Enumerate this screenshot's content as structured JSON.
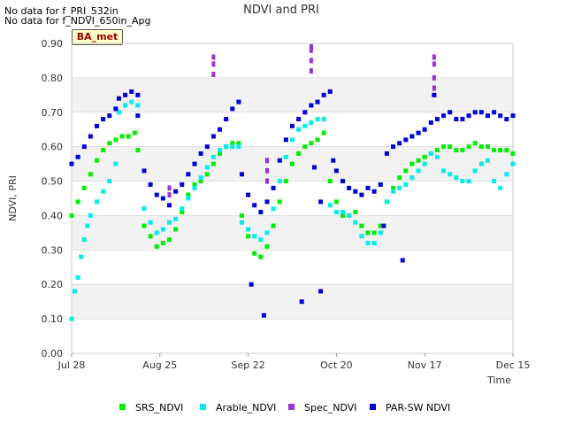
{
  "notes": [
    "No data for f_PRI_532in",
    "No data for f_NDVI_650in_Apg"
  ],
  "badge": "BA_met",
  "chart_data": {
    "type": "scatter",
    "title": "NDVI and PRI",
    "xlabel": "Time",
    "ylabel": "NDVI, PRI",
    "xlim": [
      "2019-07-28",
      "2019-12-15"
    ],
    "ylim": [
      0,
      0.9
    ],
    "x_ticks": [
      "Jul 28",
      "Aug 25",
      "Sep 22",
      "Oct 20",
      "Nov 17",
      "Dec 15"
    ],
    "y_ticks": [
      "0.00",
      "0.10",
      "0.20",
      "0.30",
      "0.40",
      "0.50",
      "0.60",
      "0.70",
      "0.80",
      "0.90"
    ],
    "grid": "horizontal bands",
    "legend_position": "bottom",
    "series": [
      {
        "name": "SRS_NDVI",
        "color": "#00ee00",
        "points": [
          [
            "2019-07-28",
            0.4
          ],
          [
            "2019-07-30",
            0.44
          ],
          [
            "2019-08-01",
            0.48
          ],
          [
            "2019-08-03",
            0.52
          ],
          [
            "2019-08-05",
            0.56
          ],
          [
            "2019-08-07",
            0.59
          ],
          [
            "2019-08-09",
            0.61
          ],
          [
            "2019-08-11",
            0.62
          ],
          [
            "2019-08-13",
            0.63
          ],
          [
            "2019-08-15",
            0.63
          ],
          [
            "2019-08-17",
            0.64
          ],
          [
            "2019-08-18",
            0.59
          ],
          [
            "2019-08-20",
            0.37
          ],
          [
            "2019-08-22",
            0.34
          ],
          [
            "2019-08-24",
            0.31
          ],
          [
            "2019-08-26",
            0.32
          ],
          [
            "2019-08-28",
            0.33
          ],
          [
            "2019-08-30",
            0.36
          ],
          [
            "2019-09-01",
            0.41
          ],
          [
            "2019-09-03",
            0.46
          ],
          [
            "2019-09-05",
            0.49
          ],
          [
            "2019-09-07",
            0.5
          ],
          [
            "2019-09-09",
            0.52
          ],
          [
            "2019-09-11",
            0.55
          ],
          [
            "2019-09-13",
            0.58
          ],
          [
            "2019-09-15",
            0.6
          ],
          [
            "2019-09-17",
            0.61
          ],
          [
            "2019-09-19",
            0.61
          ],
          [
            "2019-09-20",
            0.4
          ],
          [
            "2019-09-22",
            0.34
          ],
          [
            "2019-09-24",
            0.29
          ],
          [
            "2019-09-26",
            0.28
          ],
          [
            "2019-09-28",
            0.31
          ],
          [
            "2019-09-30",
            0.37
          ],
          [
            "2019-10-02",
            0.44
          ],
          [
            "2019-10-04",
            0.5
          ],
          [
            "2019-10-06",
            0.55
          ],
          [
            "2019-10-08",
            0.58
          ],
          [
            "2019-10-10",
            0.6
          ],
          [
            "2019-10-12",
            0.61
          ],
          [
            "2019-10-14",
            0.62
          ],
          [
            "2019-10-16",
            0.64
          ],
          [
            "2019-10-18",
            0.5
          ],
          [
            "2019-10-20",
            0.44
          ],
          [
            "2019-10-22",
            0.4
          ],
          [
            "2019-10-24",
            0.4
          ],
          [
            "2019-10-26",
            0.41
          ],
          [
            "2019-10-28",
            0.37
          ],
          [
            "2019-10-30",
            0.35
          ],
          [
            "2019-11-01",
            0.35
          ],
          [
            "2019-11-03",
            0.37
          ],
          [
            "2019-11-05",
            0.44
          ],
          [
            "2019-11-07",
            0.48
          ],
          [
            "2019-11-09",
            0.51
          ],
          [
            "2019-11-11",
            0.53
          ],
          [
            "2019-11-13",
            0.55
          ],
          [
            "2019-11-15",
            0.56
          ],
          [
            "2019-11-17",
            0.57
          ],
          [
            "2019-11-19",
            0.58
          ],
          [
            "2019-11-21",
            0.59
          ],
          [
            "2019-11-23",
            0.6
          ],
          [
            "2019-11-25",
            0.6
          ],
          [
            "2019-11-27",
            0.59
          ],
          [
            "2019-11-29",
            0.59
          ],
          [
            "2019-12-01",
            0.6
          ],
          [
            "2019-12-03",
            0.61
          ],
          [
            "2019-12-05",
            0.6
          ],
          [
            "2019-12-07",
            0.6
          ],
          [
            "2019-12-09",
            0.59
          ],
          [
            "2019-12-11",
            0.59
          ],
          [
            "2019-12-13",
            0.59
          ],
          [
            "2019-12-15",
            0.58
          ]
        ]
      },
      {
        "name": "Arable_NDVI",
        "color": "#00eeee",
        "points": [
          [
            "2019-07-28",
            0.1
          ],
          [
            "2019-07-29",
            0.18
          ],
          [
            "2019-07-30",
            0.22
          ],
          [
            "2019-07-31",
            0.28
          ],
          [
            "2019-08-01",
            0.33
          ],
          [
            "2019-08-02",
            0.37
          ],
          [
            "2019-08-03",
            0.4
          ],
          [
            "2019-08-05",
            0.44
          ],
          [
            "2019-08-07",
            0.47
          ],
          [
            "2019-08-09",
            0.5
          ],
          [
            "2019-08-11",
            0.55
          ],
          [
            "2019-08-12",
            0.7
          ],
          [
            "2019-08-14",
            0.72
          ],
          [
            "2019-08-16",
            0.73
          ],
          [
            "2019-08-18",
            0.72
          ],
          [
            "2019-08-20",
            0.42
          ],
          [
            "2019-08-22",
            0.38
          ],
          [
            "2019-08-24",
            0.35
          ],
          [
            "2019-08-26",
            0.36
          ],
          [
            "2019-08-28",
            0.38
          ],
          [
            "2019-08-30",
            0.39
          ],
          [
            "2019-09-01",
            0.42
          ],
          [
            "2019-09-03",
            0.45
          ],
          [
            "2019-09-05",
            0.48
          ],
          [
            "2019-09-07",
            0.51
          ],
          [
            "2019-09-09",
            0.54
          ],
          [
            "2019-09-11",
            0.57
          ],
          [
            "2019-09-13",
            0.59
          ],
          [
            "2019-09-15",
            0.6
          ],
          [
            "2019-09-17",
            0.6
          ],
          [
            "2019-09-19",
            0.6
          ],
          [
            "2019-09-20",
            0.38
          ],
          [
            "2019-09-22",
            0.36
          ],
          [
            "2019-09-24",
            0.34
          ],
          [
            "2019-09-26",
            0.33
          ],
          [
            "2019-09-28",
            0.35
          ],
          [
            "2019-09-30",
            0.42
          ],
          [
            "2019-10-02",
            0.5
          ],
          [
            "2019-10-04",
            0.57
          ],
          [
            "2019-10-06",
            0.62
          ],
          [
            "2019-10-08",
            0.65
          ],
          [
            "2019-10-10",
            0.66
          ],
          [
            "2019-10-12",
            0.67
          ],
          [
            "2019-10-14",
            0.68
          ],
          [
            "2019-10-16",
            0.68
          ],
          [
            "2019-10-18",
            0.43
          ],
          [
            "2019-10-20",
            0.41
          ],
          [
            "2019-10-22",
            0.41
          ],
          [
            "2019-10-24",
            0.4
          ],
          [
            "2019-10-26",
            0.38
          ],
          [
            "2019-10-28",
            0.34
          ],
          [
            "2019-10-30",
            0.32
          ],
          [
            "2019-11-01",
            0.32
          ],
          [
            "2019-11-03",
            0.35
          ],
          [
            "2019-11-05",
            0.44
          ],
          [
            "2019-11-07",
            0.47
          ],
          [
            "2019-11-09",
            0.48
          ],
          [
            "2019-11-11",
            0.49
          ],
          [
            "2019-11-13",
            0.51
          ],
          [
            "2019-11-15",
            0.53
          ],
          [
            "2019-11-17",
            0.55
          ],
          [
            "2019-11-19",
            0.58
          ],
          [
            "2019-11-21",
            0.57
          ],
          [
            "2019-11-23",
            0.53
          ],
          [
            "2019-11-25",
            0.52
          ],
          [
            "2019-11-27",
            0.51
          ],
          [
            "2019-11-29",
            0.5
          ],
          [
            "2019-12-01",
            0.5
          ],
          [
            "2019-12-03",
            0.53
          ],
          [
            "2019-12-05",
            0.55
          ],
          [
            "2019-12-07",
            0.56
          ],
          [
            "2019-12-09",
            0.5
          ],
          [
            "2019-12-11",
            0.48
          ],
          [
            "2019-12-13",
            0.52
          ],
          [
            "2019-12-15",
            0.55
          ]
        ]
      },
      {
        "name": "Spec_NDVI",
        "color": "#9b30d9",
        "points": [
          [
            "2019-08-28",
            0.46
          ],
          [
            "2019-08-28",
            0.48
          ],
          [
            "2019-09-11",
            0.81
          ],
          [
            "2019-09-11",
            0.84
          ],
          [
            "2019-09-11",
            0.86
          ],
          [
            "2019-09-28",
            0.5
          ],
          [
            "2019-09-28",
            0.53
          ],
          [
            "2019-09-28",
            0.56
          ],
          [
            "2019-10-12",
            0.82
          ],
          [
            "2019-10-12",
            0.85
          ],
          [
            "2019-10-12",
            0.88
          ],
          [
            "2019-10-12",
            0.89
          ],
          [
            "2019-11-20",
            0.77
          ],
          [
            "2019-11-20",
            0.8
          ],
          [
            "2019-11-20",
            0.84
          ],
          [
            "2019-11-20",
            0.86
          ]
        ]
      },
      {
        "name": "PAR-SW NDVI",
        "color": "#0000dd",
        "points": [
          [
            "2019-07-28",
            0.55
          ],
          [
            "2019-07-30",
            0.57
          ],
          [
            "2019-08-01",
            0.6
          ],
          [
            "2019-08-03",
            0.63
          ],
          [
            "2019-08-05",
            0.66
          ],
          [
            "2019-08-07",
            0.68
          ],
          [
            "2019-08-09",
            0.69
          ],
          [
            "2019-08-11",
            0.71
          ],
          [
            "2019-08-12",
            0.74
          ],
          [
            "2019-08-14",
            0.75
          ],
          [
            "2019-08-16",
            0.76
          ],
          [
            "2019-08-18",
            0.75
          ],
          [
            "2019-08-18",
            0.69
          ],
          [
            "2019-08-20",
            0.53
          ],
          [
            "2019-08-22",
            0.49
          ],
          [
            "2019-08-24",
            0.46
          ],
          [
            "2019-08-26",
            0.45
          ],
          [
            "2019-08-28",
            0.43
          ],
          [
            "2019-08-30",
            0.47
          ],
          [
            "2019-09-01",
            0.49
          ],
          [
            "2019-09-03",
            0.52
          ],
          [
            "2019-09-05",
            0.55
          ],
          [
            "2019-09-07",
            0.58
          ],
          [
            "2019-09-09",
            0.6
          ],
          [
            "2019-09-11",
            0.63
          ],
          [
            "2019-09-13",
            0.65
          ],
          [
            "2019-09-15",
            0.68
          ],
          [
            "2019-09-17",
            0.71
          ],
          [
            "2019-09-19",
            0.73
          ],
          [
            "2019-09-20",
            0.52
          ],
          [
            "2019-09-22",
            0.46
          ],
          [
            "2019-09-23",
            0.2
          ],
          [
            "2019-09-24",
            0.43
          ],
          [
            "2019-09-26",
            0.41
          ],
          [
            "2019-09-27",
            0.11
          ],
          [
            "2019-09-28",
            0.44
          ],
          [
            "2019-09-30",
            0.48
          ],
          [
            "2019-10-02",
            0.56
          ],
          [
            "2019-10-04",
            0.62
          ],
          [
            "2019-10-06",
            0.66
          ],
          [
            "2019-10-08",
            0.68
          ],
          [
            "2019-10-09",
            0.15
          ],
          [
            "2019-10-10",
            0.7
          ],
          [
            "2019-10-12",
            0.72
          ],
          [
            "2019-10-13",
            0.54
          ],
          [
            "2019-10-14",
            0.73
          ],
          [
            "2019-10-15",
            0.44
          ],
          [
            "2019-10-15",
            0.18
          ],
          [
            "2019-10-16",
            0.75
          ],
          [
            "2019-10-18",
            0.76
          ],
          [
            "2019-10-19",
            0.56
          ],
          [
            "2019-10-20",
            0.53
          ],
          [
            "2019-10-22",
            0.5
          ],
          [
            "2019-10-24",
            0.48
          ],
          [
            "2019-10-26",
            0.47
          ],
          [
            "2019-10-28",
            0.46
          ],
          [
            "2019-10-30",
            0.48
          ],
          [
            "2019-11-01",
            0.47
          ],
          [
            "2019-11-03",
            0.49
          ],
          [
            "2019-11-04",
            0.37
          ],
          [
            "2019-11-05",
            0.58
          ],
          [
            "2019-11-07",
            0.6
          ],
          [
            "2019-11-09",
            0.61
          ],
          [
            "2019-11-10",
            0.27
          ],
          [
            "2019-11-11",
            0.62
          ],
          [
            "2019-11-13",
            0.63
          ],
          [
            "2019-11-15",
            0.64
          ],
          [
            "2019-11-17",
            0.65
          ],
          [
            "2019-11-19",
            0.67
          ],
          [
            "2019-11-20",
            0.75
          ],
          [
            "2019-11-21",
            0.68
          ],
          [
            "2019-11-23",
            0.69
          ],
          [
            "2019-11-25",
            0.7
          ],
          [
            "2019-11-27",
            0.68
          ],
          [
            "2019-11-29",
            0.68
          ],
          [
            "2019-12-01",
            0.69
          ],
          [
            "2019-12-03",
            0.7
          ],
          [
            "2019-12-05",
            0.7
          ],
          [
            "2019-12-07",
            0.69
          ],
          [
            "2019-12-09",
            0.7
          ],
          [
            "2019-12-11",
            0.69
          ],
          [
            "2019-12-13",
            0.68
          ],
          [
            "2019-12-15",
            0.69
          ]
        ]
      }
    ]
  }
}
